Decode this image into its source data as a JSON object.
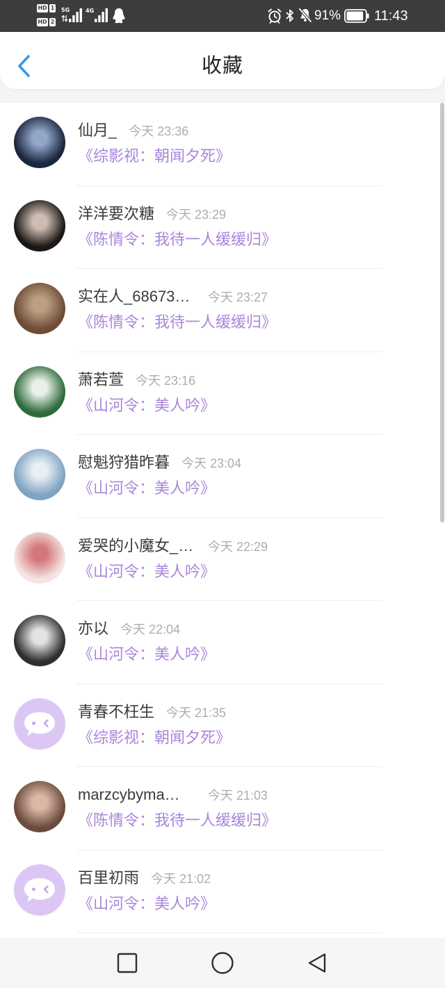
{
  "status_bar": {
    "sim1_label": "HD",
    "sim1_index": "1",
    "sim2_label": "HD",
    "sim2_index": "2",
    "network1": "5G",
    "network2": "4G",
    "battery_percent": "91%",
    "battery_level": 0.91,
    "time": "11:43",
    "left_icons": [
      "signal-5g-icon",
      "signal-4g-icon",
      "qq-icon"
    ],
    "right_icons": [
      "alarm-icon",
      "bluetooth-icon",
      "bell-off-icon",
      "battery-icon"
    ]
  },
  "header": {
    "back_icon": "chevron-left-icon",
    "title": "收藏"
  },
  "favorites": [
    {
      "name": "仙月_",
      "time": "今天 23:36",
      "book": "《综影视：朝闻夕死》",
      "avatar": {
        "colors": [
          "#1b2640",
          "#93a6c8"
        ]
      }
    },
    {
      "name": "洋洋要次糖",
      "time": "今天 23:29",
      "book": "《陈情令：我待一人缓缓归》",
      "avatar": {
        "colors": [
          "#1c1716",
          "#cdbcb2"
        ]
      }
    },
    {
      "name": "实在人_68673…",
      "time": "今天 23:27",
      "book": "《陈情令：我待一人缓缓归》",
      "avatar": {
        "colors": [
          "#6e4c36",
          "#bda083"
        ]
      }
    },
    {
      "name": "萧若萱",
      "time": "今天 23:16",
      "book": "《山河令：美人吟》",
      "avatar": {
        "colors": [
          "#2e6a3b",
          "#e9f1eb"
        ]
      }
    },
    {
      "name": "慰魁狩猎昨暮",
      "time": "今天 23:04",
      "book": "《山河令：美人吟》",
      "avatar": {
        "colors": [
          "#7fa3c2",
          "#e8eff5"
        ]
      }
    },
    {
      "name": "爱哭的小魔女_…",
      "time": "今天 22:29",
      "book": "《山河令：美人吟》",
      "avatar": {
        "colors": [
          "#f4e4e2",
          "#d4777c"
        ]
      }
    },
    {
      "name": "亦以",
      "time": "今天 22:04",
      "book": "《山河令：美人吟》",
      "avatar": {
        "colors": [
          "#2e2e2e",
          "#e3e3e3"
        ]
      }
    },
    {
      "name": "青春不枉生",
      "time": "今天 21:35",
      "book": "《综影视：朝闻夕死》",
      "avatar": {
        "icon": "default-avatar-icon"
      }
    },
    {
      "name": "marzcybyma…",
      "time": "今天 21:03",
      "book": "《陈情令：我待一人缓缓归》",
      "avatar": {
        "colors": [
          "#6b4b3e",
          "#dcb7a6"
        ]
      }
    },
    {
      "name": "百里初雨",
      "time": "今天 21:02",
      "book": "《山河令：美人吟》",
      "avatar": {
        "icon": "default-avatar-icon"
      }
    }
  ],
  "nav_bar": {
    "buttons": [
      "recent-apps-icon",
      "home-icon",
      "back-icon"
    ]
  },
  "colors": {
    "status_bar_bg": "#3d3d3d",
    "accent": "#2e9bef",
    "name_text": "#3b3b3b",
    "time_text": "#adadad",
    "book_text": "#a985db",
    "default_avatar_bg": "#dcc7f4",
    "default_avatar_eye": "#c4a2ec"
  }
}
